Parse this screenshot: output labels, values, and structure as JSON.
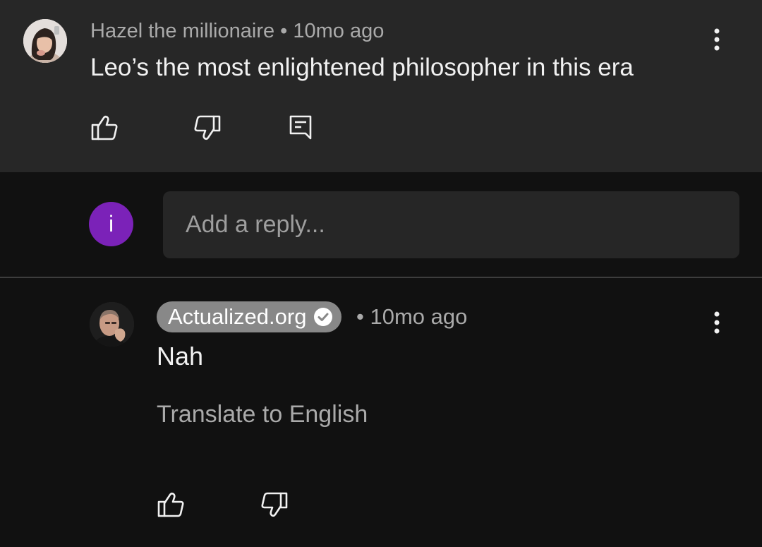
{
  "comment": {
    "author": "Hazel the millionaire",
    "separator": "•",
    "time": "10mo ago",
    "meta": "Hazel the millionaire • 10mo ago",
    "text": "Leo’s the most enlightened philosopher in this era",
    "icons": {
      "avatar": "user-avatar-photo",
      "more": "more-vertical-icon",
      "like": "thumbs-up-icon",
      "dislike": "thumbs-down-icon",
      "reply": "reply-comment-icon"
    }
  },
  "reply_box": {
    "avatar_letter": "i",
    "avatar_color": "#7b22b8",
    "placeholder": "Add a reply..."
  },
  "reply": {
    "author": "Actualized.org",
    "verified": true,
    "time_meta": "• 10mo ago",
    "text": "Nah",
    "translate_label": "Translate to English",
    "icons": {
      "avatar": "creator-avatar-photo",
      "verified": "verified-check-icon",
      "more": "more-vertical-icon",
      "like": "thumbs-up-icon",
      "dislike": "thumbs-down-icon"
    }
  },
  "colors": {
    "background": "#111111",
    "highlighted_background": "#272727",
    "primary_text": "#f1f1f1",
    "secondary_text": "#aaaaaa",
    "badge_background": "#888888"
  }
}
